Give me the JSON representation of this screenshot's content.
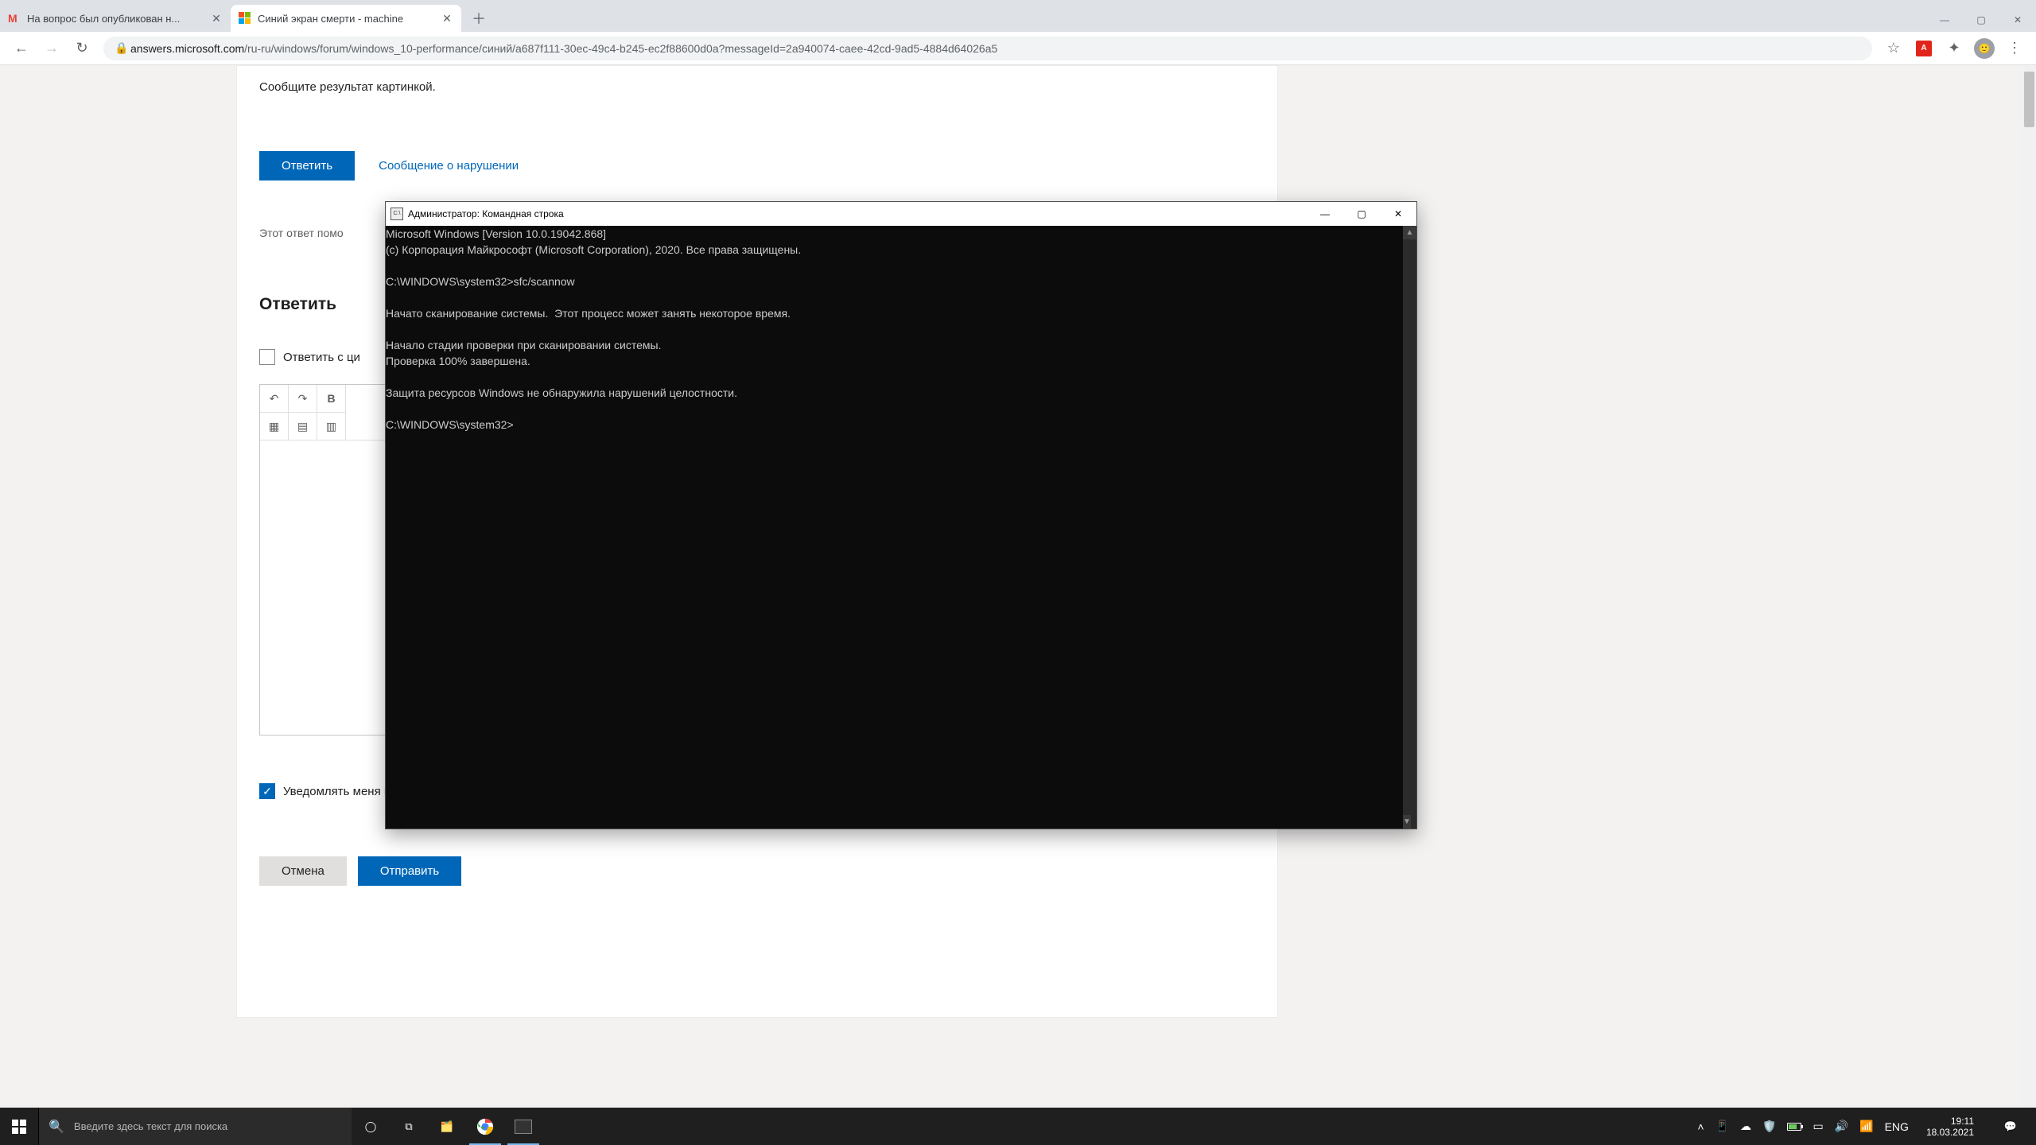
{
  "browser": {
    "tabs": [
      {
        "title": "На вопрос был опубликован н...",
        "active": false
      },
      {
        "title": "Синий экран смерти - machine",
        "active": true
      }
    ],
    "window_controls": {
      "min": "—",
      "max": "▢",
      "close": "✕"
    },
    "nav": {
      "back": "←",
      "forward": "→",
      "reload": "↻"
    },
    "url_host": "answers.microsoft.com",
    "url_path": "/ru-ru/windows/forum/windows_10-performance/синий/a687f111-30ec-49c4-b245-ec2f88600d0a?messageId=2a940074-caee-42cd-9ad5-4884d64026a5",
    "star": "☆",
    "menu": "⋮"
  },
  "page": {
    "msg_text": "Сообщите результат картинкой.",
    "reply_btn": "Ответить",
    "report_link": "Сообщение о нарушении",
    "helpful_text": "Этот ответ помо",
    "reply_heading": "Ответить",
    "quote_checkbox_label": "Ответить с ци",
    "notify_checkbox_label": "Уведомлять меня при размещении ответов на публикацию",
    "cancel_btn": "Отмена",
    "submit_btn": "Отправить",
    "rte_icons": {
      "undo": "↶",
      "redo": "↷",
      "bold": "B",
      "img": "▦",
      "code": "▤",
      "table": "▥"
    }
  },
  "cmd": {
    "title": "Администратор: Командная строка",
    "controls": {
      "min": "—",
      "max": "▢",
      "close": "✕"
    },
    "lines": [
      "Microsoft Windows [Version 10.0.19042.868]",
      "(c) Корпорация Майкрософт (Microsoft Corporation), 2020. Все права защищены.",
      "",
      "C:\\WINDOWS\\system32>sfc/scannow",
      "",
      "Начато сканирование системы.  Этот процесс может занять некоторое время.",
      "",
      "Начало стадии проверки при сканировании системы.",
      "Проверка 100% завершена.",
      "",
      "Защита ресурсов Windows не обнаружила нарушений целостности.",
      "",
      "C:\\WINDOWS\\system32>"
    ]
  },
  "taskbar": {
    "search_placeholder": "Введите здесь текст для поиска",
    "lang": "ENG",
    "time": "19:11",
    "date": "18.03.2021"
  }
}
